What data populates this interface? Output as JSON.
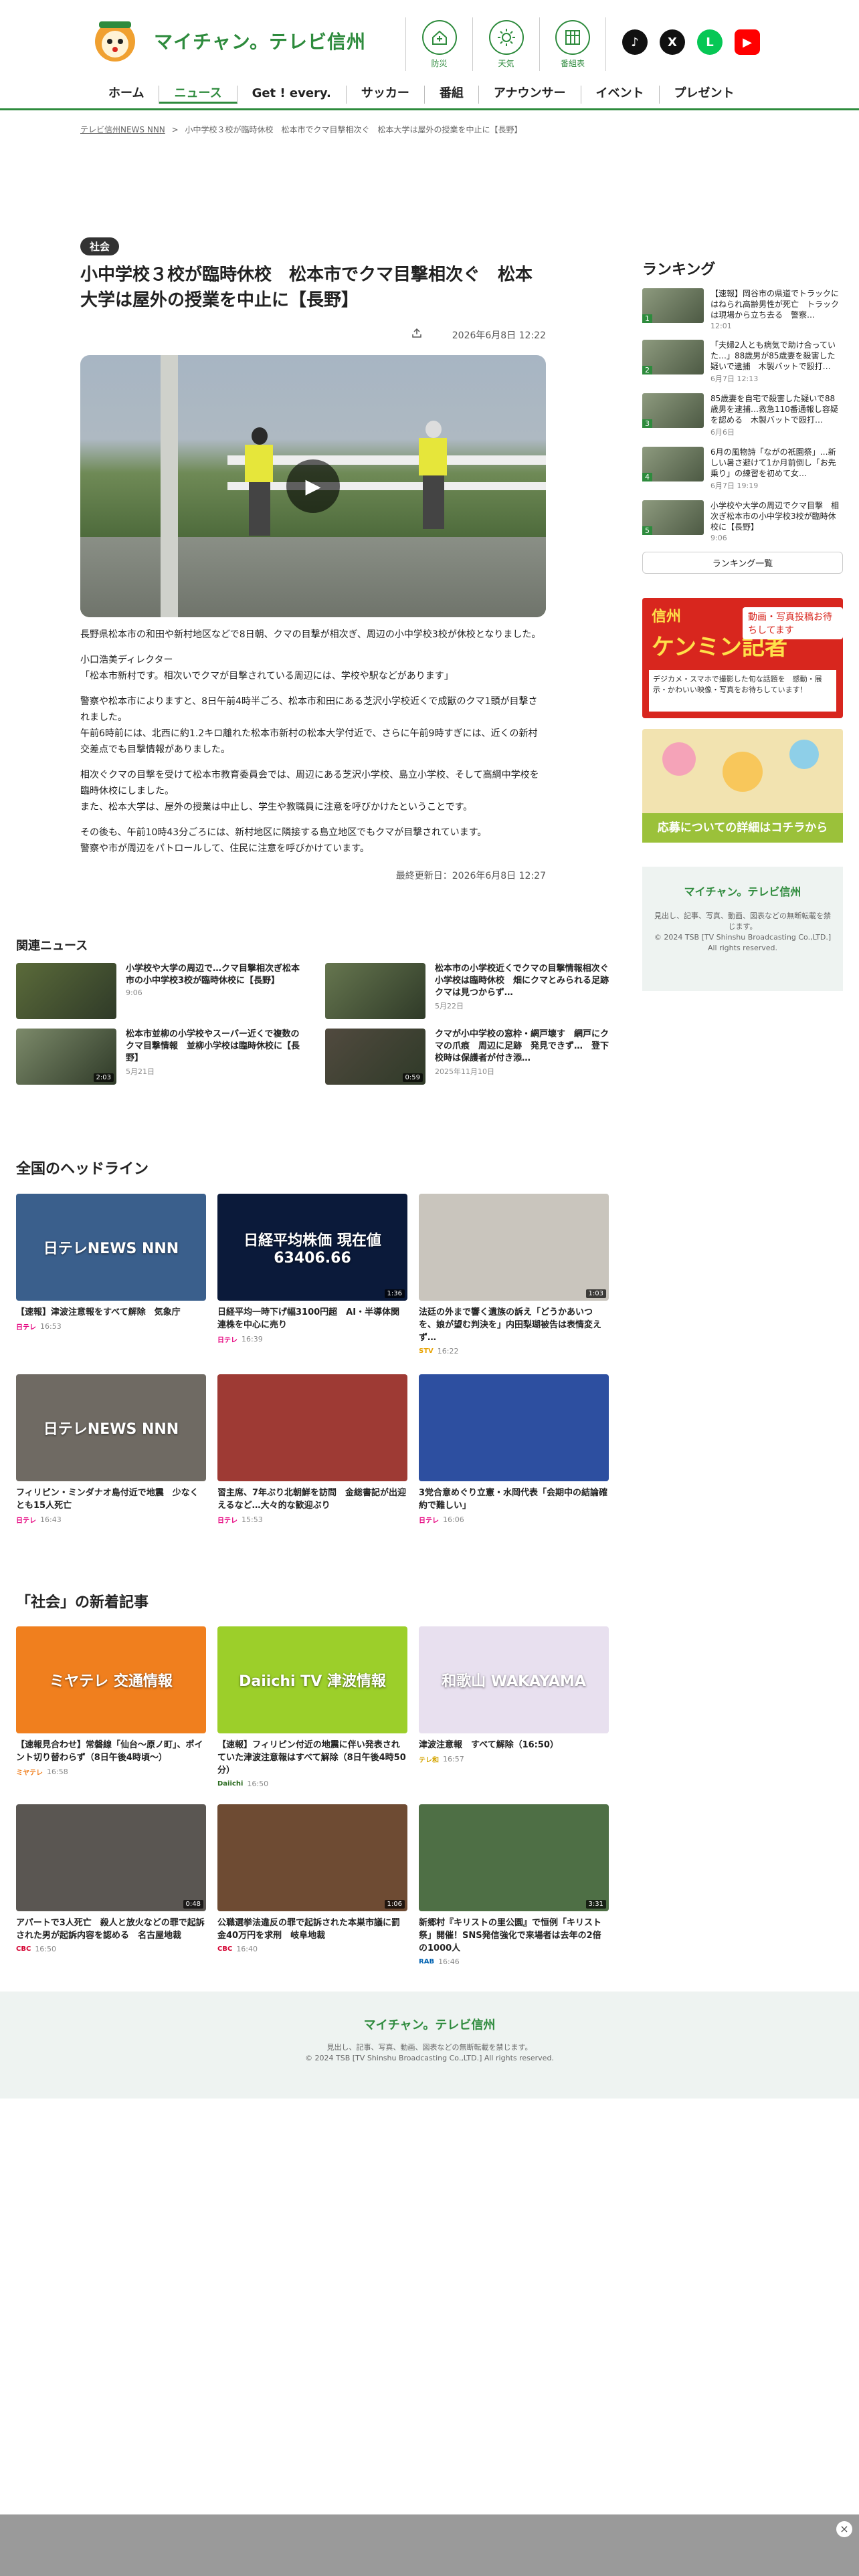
{
  "header": {
    "logo_text": "マイチャン。テレビ信州",
    "icons": [
      {
        "label": "防災",
        "icon": "home-shield-icon"
      },
      {
        "label": "天気",
        "icon": "sun-icon"
      },
      {
        "label": "番組表",
        "icon": "grid-icon"
      }
    ],
    "sns": [
      {
        "icon": "tiktok-icon",
        "color": "#111111",
        "glyph": "♪"
      },
      {
        "icon": "x-icon",
        "color": "#111111",
        "glyph": "X"
      },
      {
        "icon": "line-icon",
        "color": "#06c755",
        "glyph": "L"
      },
      {
        "icon": "youtube-icon",
        "color": "#ff0000",
        "glyph": "▶"
      }
    ],
    "nav": [
      "ホーム",
      "ニュース",
      "Get ! every.",
      "サッカー",
      "番組",
      "アナウンサー",
      "イベント",
      "プレゼント"
    ]
  },
  "breadcrumb": {
    "home": "テレビ信州NEWS NNN",
    "sep": ">",
    "current": "小中学校３校が臨時休校　松本市でクマ目撃相次ぐ　松本大学は屋外の授業を中止に【長野】"
  },
  "article": {
    "category": "社会",
    "title": "小中学校３校が臨時休校　松本市でクマ目撃相次ぐ　松本大学は屋外の授業を中止に【長野】",
    "date": "2026年6月8日 12:22",
    "paragraphs": [
      "長野県松本市の和田や新村地区などで8日朝、クマの目撃が相次ぎ、周辺の小中学校3校が休校となりました。",
      "小口浩美ディレクター\n「松本市新村です。相次いでクマが目撃されている周辺には、学校や駅などがあります」",
      "警察や松本市によりますと、8日午前4時半ごろ、松本市和田にある芝沢小学校近くで成獣のクマ1頭が目撃されました。\n午前6時前には、北西に約1.2キロ離れた松本市新村の松本大学付近で、さらに午前9時すぎには、近くの新村交差点でも目撃情報がありました。",
      "相次ぐクマの目撃を受けて松本市教育委員会では、周辺にある芝沢小学校、島立小学校、そして高綱中学校を臨時休校にしました。\nまた、松本大学は、屋外の授業は中止し、学生や教職員に注意を呼びかけたということです。",
      "その後も、午前10時43分ごろには、新村地区に隣接する島立地区でもクマが目撃されています。\n警察や市が周辺をパトロールして、住民に注意を呼びかけています。"
    ],
    "updated": "最終更新日：2026年6月8日 12:27"
  },
  "ranking": {
    "heading": "ランキング",
    "items": [
      {
        "n": "1",
        "title": "【速報】岡谷市の県道でトラックにはねられ高齢男性が死亡　トラックは現場から立ち去る　警察…",
        "date": "12:01"
      },
      {
        "n": "2",
        "title": "「夫婦2人とも病気で助け合っていた…」88歳男が85歳妻を殺害した疑いで逮捕　木製バットで殴打…",
        "date": "6月7日 12:13"
      },
      {
        "n": "3",
        "title": "85歳妻を自宅で殺害した疑いで88歳男を逮捕…救急110番通報し容疑を認める　木製バットで殴打…",
        "date": "6月6日"
      },
      {
        "n": "4",
        "title": "6月の風物詩「ながの祇園祭」…新しい暑さ避けて1か月前倒し「お先乗り」の練習を初めて女…",
        "date": "6月7日 19:19"
      },
      {
        "n": "5",
        "title": "小学校や大学の周辺でクマ目撃　相次ぎ松本市の小中学校3校が臨時休校に【長野】",
        "date": "9:06"
      }
    ],
    "more": "ランキング一覧"
  },
  "ads": {
    "ad1_line1": "信州",
    "ad1_line2": "ケンミン記者",
    "ad1_tag": "動画・写真投稿お待ちしてます",
    "ad1_body": "デジカメ・スマホで撮影した旬な話題を　感動・展示・かわいい映像・写真をお待ちしています！",
    "ad2_bottom": "応募についての詳細はコチラから"
  },
  "sidefoot": {
    "logo": "マイチャン。テレビ信州",
    "text": "見出し、記事、写真、動画、図表などの無断転載を禁じます。\n© 2024 TSB [TV Shinshu Broadcasting Co.,LTD.] All rights reserved."
  },
  "related": {
    "heading": "関連ニュース",
    "items": [
      {
        "title": "小学校や大学の周辺で…クマ目撃相次ぎ松本市の小中学校3校が臨時休校に【長野】",
        "date": "9:06",
        "duration": "",
        "color": "#5b6b3a"
      },
      {
        "title": "松本市の小学校近くでクマの目撃情報相次ぐ　小学校は臨時休校　畑にクマとみられる足跡　クマは見つからず…",
        "date": "5月22日",
        "duration": "",
        "color": "#66764f"
      },
      {
        "title": "松本市並柳の小学校やスーパー近くで複数のクマ目撃情報　並柳小学校は臨時休校に【長野】",
        "date": "5月21日",
        "duration": "2:03",
        "color": "#7c8a6a"
      },
      {
        "title": "クマが小中学校の窓枠・網戸壊す　網戸にクマの爪痕　周辺に足跡　発見できず…　登下校時は保護者が付き添…",
        "date": "2025年11月10日",
        "duration": "0:59",
        "color": "#514a3f"
      }
    ]
  },
  "national": {
    "heading": "全国のヘッドライン",
    "items": [
      {
        "title": "【速報】津波注意報をすべて解除　気象庁",
        "time": "16:53",
        "src": "日テレ",
        "srccolor": "#e6007e",
        "duration": "",
        "bg": "#3a5f8c",
        "overlay": "日テレNEWS NNN"
      },
      {
        "title": "日経平均一時下げ幅3100円超　AI・半導体関連株を中心に売り",
        "time": "16:39",
        "src": "日テレ",
        "srccolor": "#e6007e",
        "duration": "1:36",
        "bg": "#0b1a3a",
        "overlay": "日経平均株価 現在値 63406.66"
      },
      {
        "title": "法廷の外まで響く遺族の訴え「どうかあいつを、娘が望む判決を」内田梨瑚被告は表情変えず…",
        "time": "16:22",
        "src": "STV",
        "srccolor": "#e8a300",
        "duration": "1:03",
        "bg": "#c9c5bd",
        "overlay": ""
      },
      {
        "title": "フィリピン・ミンダナオ島付近で地震　少なくとも15人死亡",
        "time": "16:43",
        "src": "日テレ",
        "srccolor": "#e6007e",
        "duration": "",
        "bg": "#6f6a63",
        "overlay": "日テレNEWS NNN"
      },
      {
        "title": "習主席、7年ぶり北朝鮮を訪問　金総書記が出迎えるなど…大々的な歓迎ぶり",
        "time": "15:53",
        "src": "日テレ",
        "srccolor": "#e6007e",
        "duration": "",
        "bg": "#9e3a34",
        "overlay": ""
      },
      {
        "title": "3党合意めぐり立憲・水岡代表「会期中の結論確約で難しい」",
        "time": "16:06",
        "src": "日テレ",
        "srccolor": "#e6007e",
        "duration": "",
        "bg": "#2d4fa0",
        "overlay": ""
      }
    ]
  },
  "society": {
    "heading": "「社会」の新着記事",
    "items": [
      {
        "title": "【速報見合わせ】常磐線「仙台～原ノ町」、ポイント切り替わらず（8日午後4時頃～）",
        "time": "16:58",
        "src": "ミヤテレ",
        "srccolor": "#f07f1e",
        "duration": "",
        "bg": "#f07f1e",
        "overlay": "ミヤテレ 交通情報"
      },
      {
        "title": "【速報】フィリピン付近の地震に伴い発表されていた津波注意報はすべて解除（8日午後4時50分）",
        "time": "16:50",
        "src": "Daiichi",
        "srccolor": "#2b6b20",
        "duration": "",
        "bg": "#9ccf2a",
        "overlay": "Daiichi TV 津波情報"
      },
      {
        "title": "津波注意報　すべて解除（16:50）",
        "time": "16:57",
        "src": "テレ和",
        "srccolor": "#d4a400",
        "duration": "",
        "bg": "#e8e0ef",
        "overlay": "和歌山 WAKAYAMA"
      },
      {
        "title": "アパートで3人死亡　殺人と放火などの罪で起訴された男が起訴内容を認める　名古屋地裁",
        "time": "16:50",
        "src": "CBC",
        "srccolor": "#d40030",
        "duration": "0:48",
        "bg": "#5a5652",
        "overlay": ""
      },
      {
        "title": "公職選挙法違反の罪で起訴された本巣市議に罰金40万円を求刑　岐阜地裁",
        "time": "16:40",
        "src": "CBC",
        "srccolor": "#d40030",
        "duration": "1:06",
        "bg": "#6e4b33",
        "overlay": ""
      },
      {
        "title": "新郷村『キリストの里公園』で恒例「キリスト祭」開催！SNS発信強化で来場者は去年の2倍の1000人",
        "time": "16:46",
        "src": "RAB",
        "srccolor": "#0062b1",
        "duration": "3:31",
        "bg": "#4e6f45",
        "overlay": ""
      }
    ]
  },
  "footer": {
    "logo": "マイチャン。テレビ信州",
    "line1": "見出し、記事、写真、動画、図表などの無断転載を禁じます。",
    "line2": "© 2024 TSB [TV Shinshu Broadcasting Co.,LTD.] All rights reserved."
  },
  "ad_close": "×",
  "colors": {
    "brand": "#2e8b3d"
  }
}
